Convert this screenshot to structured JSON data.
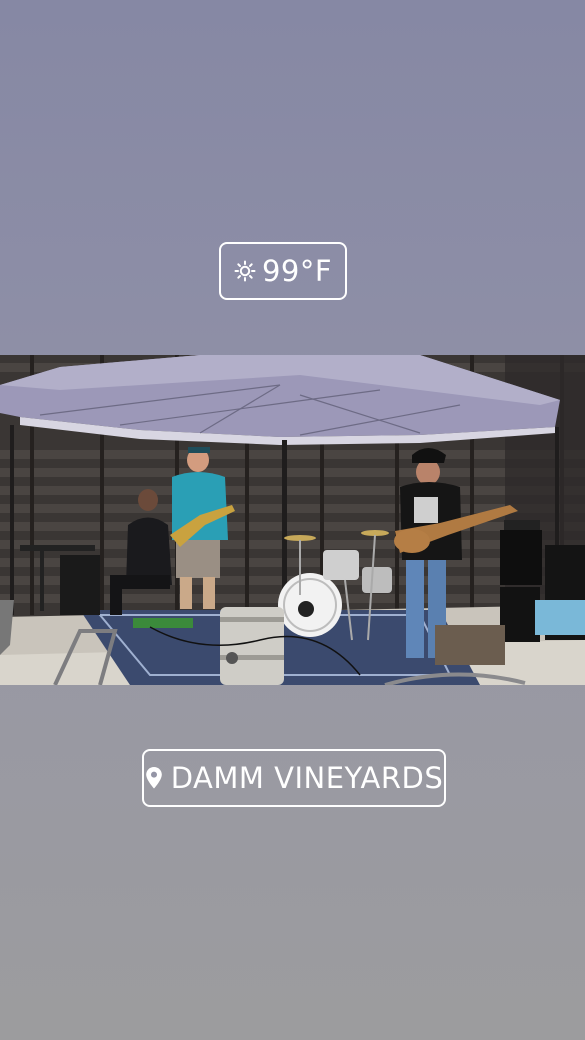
{
  "weather_sticker": {
    "icon": "sun-icon",
    "temperature": "99°F"
  },
  "location_sticker": {
    "icon": "location-pin-icon",
    "place": "DAMM VINEYARDS"
  },
  "photo": {
    "subject": "band-performing-under-canopy"
  }
}
